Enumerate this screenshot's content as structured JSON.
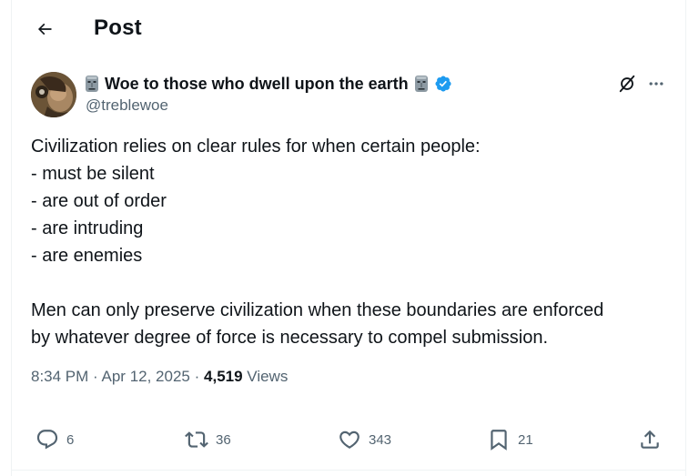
{
  "header": {
    "title": "Post",
    "back_icon": "arrow-left-icon"
  },
  "author": {
    "display_name": "Woe to those who dwell upon the earth",
    "handle": "@treblewoe",
    "verified": true,
    "name_emoji": "moai-icon",
    "verified_color": "#1d9bf0"
  },
  "tweet": {
    "text": "Civilization relies on clear rules for when certain people:\n- must be silent\n- are out of order\n- are intruding\n- are enemies\n\nMen can only preserve civilization when these boundaries are enforced\nby whatever degree of force is necessary to compel submission."
  },
  "meta": {
    "time": "8:34 PM",
    "date": "Apr 12, 2025",
    "separator": "·",
    "views_count": "4,519",
    "views_label": "Views"
  },
  "actions": {
    "replies": "6",
    "reposts": "36",
    "likes": "343",
    "bookmarks": "21"
  },
  "colors": {
    "text": "#0f1419",
    "secondary": "#536471",
    "accent": "#1d9bf0"
  }
}
